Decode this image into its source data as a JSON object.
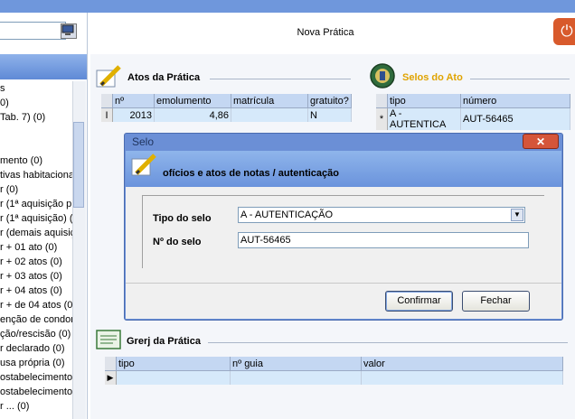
{
  "window": {
    "title": "Nova Prática",
    "close_glyph": "⏻"
  },
  "left_pane": {
    "tree_items": [
      "s",
      "0)",
      "Tab. 7) (0)",
      "",
      "",
      "mento (0)",
      "tivas habitaciona",
      "r (0)",
      "r (1ª aquisição p",
      "r (1ª aquisição) (",
      "r (demais aquisiç",
      "r + 01 ato (0)",
      "r + 02 atos (0)",
      "r + 03 atos (0)",
      "r + 04 atos (0)",
      "r + de 04 atos (0",
      "enção de condor",
      "ção/rescisão (0)",
      "r declarado (0)",
      "usa própria (0)",
      "ostabelecimento",
      "ostabelecimento",
      "r ... (0)"
    ]
  },
  "atos": {
    "title": "Atos da Prática",
    "columns": [
      "nº",
      "emolumento",
      "matrícula",
      "gratuito?"
    ],
    "row": {
      "marker": "I",
      "n": "2013",
      "emolumento": "4,86",
      "matricula": "",
      "gratuito": "N"
    }
  },
  "selos": {
    "title": "Selos do Ato",
    "columns": [
      "tipo",
      "número"
    ],
    "row": {
      "marker": "*",
      "tipo": "A - AUTENTICA",
      "numero": "AUT-56465"
    }
  },
  "grerj": {
    "title": "Grerj da Prática",
    "columns": [
      "tipo",
      "nº guia",
      "valor"
    ],
    "row_marker": "▶"
  },
  "dialog": {
    "title": "Selo",
    "close_glyph": "✕",
    "heading": "ofícios e atos de notas / autenticação",
    "tipo_label": "Tipo do selo",
    "tipo_value": "A - AUTENTICAÇÃO",
    "numero_label": "Nº do selo",
    "numero_value": "AUT-56465",
    "confirm_label": "Confirmar",
    "close_label": "Fechar"
  }
}
